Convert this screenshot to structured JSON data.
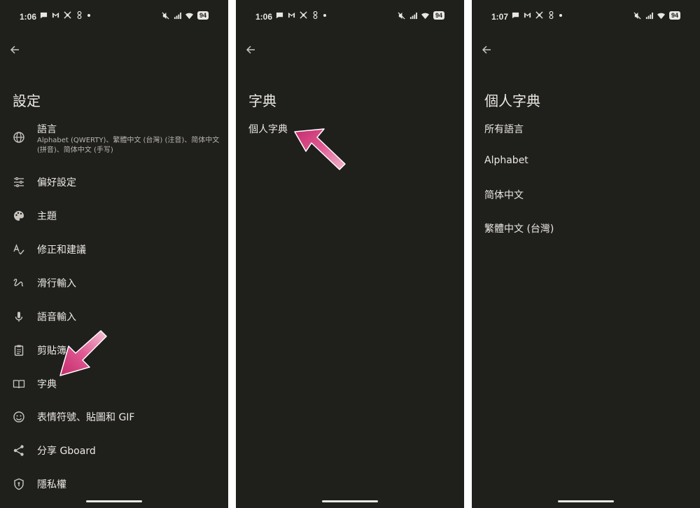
{
  "screens": [
    {
      "status": {
        "time": "1:06",
        "battery": "94"
      },
      "title": "設定",
      "items": [
        {
          "label": "語言",
          "sub": "Alphabet (QWERTY)、繁體中文 (台灣) (注音)、简体中文 (拼音)、简体中文 (手写)",
          "icon": "globe-icon"
        },
        {
          "label": "偏好設定",
          "icon": "sliders-icon"
        },
        {
          "label": "主題",
          "icon": "palette-icon"
        },
        {
          "label": "修正和建議",
          "icon": "spellcheck-icon"
        },
        {
          "label": "滑行輸入",
          "icon": "gesture-icon"
        },
        {
          "label": "語音輸入",
          "icon": "mic-icon"
        },
        {
          "label": "剪貼簿",
          "icon": "clipboard-icon"
        },
        {
          "label": "字典",
          "icon": "book-icon"
        },
        {
          "label": "表情符號、貼圖和 GIF",
          "icon": "smiley-icon"
        },
        {
          "label": "分享 Gboard",
          "icon": "share-icon"
        },
        {
          "label": "隱私權",
          "icon": "shield-icon"
        }
      ]
    },
    {
      "status": {
        "time": "1:06",
        "battery": "94"
      },
      "title": "字典",
      "items": [
        {
          "label": "個人字典"
        }
      ]
    },
    {
      "status": {
        "time": "1:07",
        "battery": "94"
      },
      "title": "個人字典",
      "items": [
        {
          "label": "所有語言"
        },
        {
          "label": "Alphabet"
        },
        {
          "label": "简体中文"
        },
        {
          "label": "繁體中文 (台灣)"
        }
      ]
    }
  ],
  "colors": {
    "background": "#1f1f1c",
    "text": "#ece9e3",
    "arrow": "#d63d7f"
  }
}
